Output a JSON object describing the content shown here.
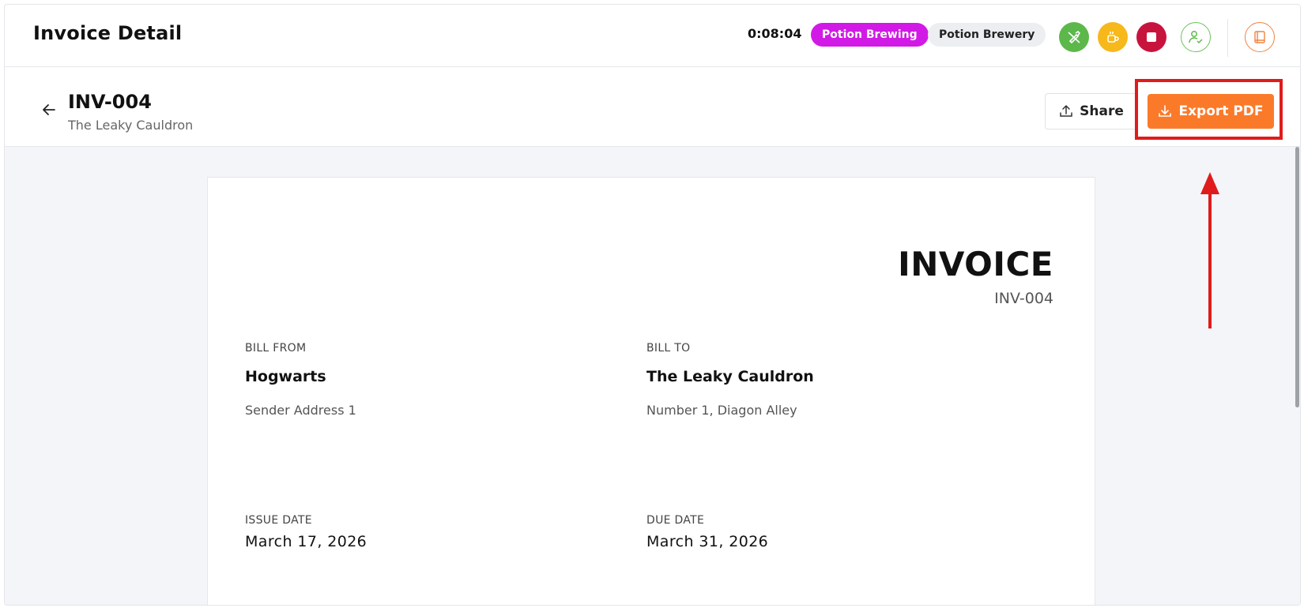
{
  "header": {
    "title": "Invoice Detail",
    "timer": "0:08:04",
    "tag_primary": "Potion Brewing",
    "tag_secondary": "Potion Brewery",
    "icons": [
      "pen-slash-icon",
      "coffee-cup-icon",
      "stop-icon",
      "user-check-icon",
      "book-icon"
    ],
    "colors": {
      "green": "#5cb84a",
      "yellow": "#f6b81b",
      "red": "#c8143c",
      "magenta": "#d21ae6",
      "orange": "#fb7a2a"
    }
  },
  "subheader": {
    "invoice_id": "INV-004",
    "client": "The Leaky Cauldron",
    "share_label": "Share",
    "export_label": "Export PDF"
  },
  "invoice": {
    "heading": "INVOICE",
    "number": "INV-004",
    "bill_from_label": "BILL FROM",
    "bill_from_name": "Hogwarts",
    "bill_from_address": "Sender Address 1",
    "bill_to_label": "BILL TO",
    "bill_to_name": "The Leaky Cauldron",
    "bill_to_address": "Number 1, Diagon Alley",
    "issue_date_label": "ISSUE DATE",
    "issue_date": "March 17, 2026",
    "due_date_label": "DUE DATE",
    "due_date": "March 31, 2026"
  }
}
